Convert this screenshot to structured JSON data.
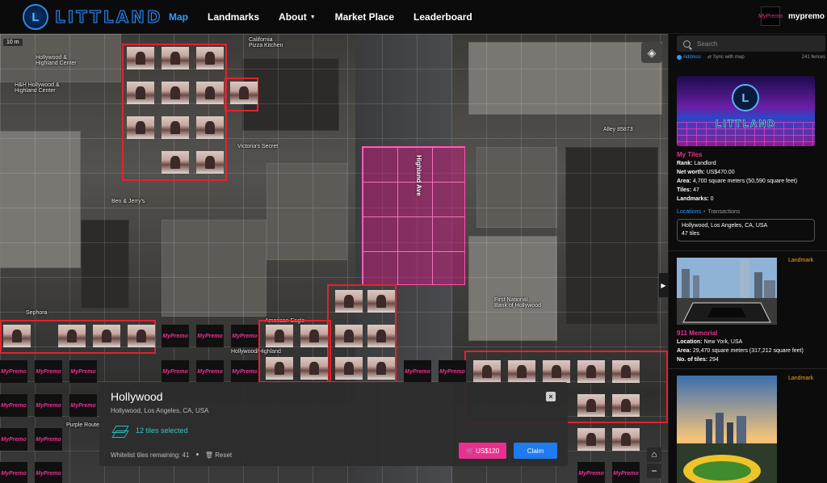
{
  "nav": {
    "logo_text": "LITTLAND",
    "links": [
      {
        "label": "Map",
        "active": true
      },
      {
        "label": "Landmarks",
        "active": false
      },
      {
        "label": "About",
        "active": false,
        "dropdown": true
      },
      {
        "label": "Market Place",
        "active": false
      },
      {
        "label": "Leaderboard",
        "active": false
      }
    ],
    "user": {
      "avatar_text": "MyPremo",
      "name": "mypremo"
    }
  },
  "map": {
    "scale": "10 m",
    "labels": {
      "hollywood_highland": "Hollywood &\nHighland Center",
      "hh_hollywood": "H&H Hollywood &\nHighland Center",
      "california_pizza": "California\nPizza Kitchen",
      "victorias_secret": "Victoria's Secret",
      "alley": "Alley 85873",
      "highland_ave": "Highland Ave",
      "first_national": "First National\nBank of Hollywood",
      "sephora": "Sephora",
      "american_eagle": "American Eagle",
      "ben_jerry": "Ben & Jerry's",
      "purple_route": "Purple Route 1",
      "hollywood_highland_small": "Hollywood/Highland"
    },
    "tile_brand": "MyPremo"
  },
  "selection": {
    "title": "Hollywood",
    "subtitle": "Hollywood, Los Angeles, CA, USA",
    "tiles_selected": "12 tiles selected",
    "whitelist": "Whitelist tiles remaining: 41",
    "reset": "Reset",
    "price": "US$120",
    "claim": "Claim",
    "close": "×"
  },
  "sidebar": {
    "search_placeholder": "Search",
    "opt_address": "Address",
    "opt_sync": "Sync with map",
    "fences": "241 fences",
    "my_tiles": {
      "banner_word": "LITTLAND",
      "title": "My Tiles",
      "rank_label": "Rank:",
      "rank": "Landlord",
      "networth_label": "Net worth:",
      "networth": "US$470.00",
      "area_label": "Area:",
      "area": "4,700 square meters (50,590 square feet)",
      "tiles_label": "Tiles:",
      "tiles": "47",
      "landmarks_label": "Landmarks:",
      "landmarks": "0",
      "tab_locations": "Locations",
      "tab_transactions": "Transactions",
      "location_name": "Hollywood, Los Angeles, CA, USA",
      "location_tiles": "47 tiles"
    },
    "landmarks": [
      {
        "badge": "Landmark",
        "title": "911 Memorial",
        "location_label": "Location:",
        "location": "New York, USA",
        "area_label": "Area:",
        "area": "29,470 square meters (317,212 square feet)",
        "tiles_label": "No. of tiles:",
        "tiles": "294"
      },
      {
        "badge": "Landmark"
      }
    ]
  },
  "colors": {
    "accent_blue": "#2d9cff",
    "brand_pink": "#e8318f",
    "teal": "#2fc8c6",
    "landmark_orange": "#f0a51a",
    "fence_red": "#e0242c"
  }
}
